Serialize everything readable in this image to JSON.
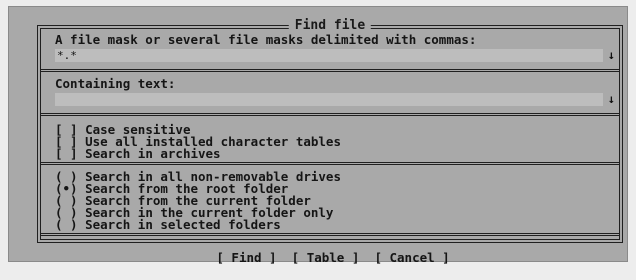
{
  "dialog": {
    "title": "Find file",
    "mask_label": "A file mask or several file masks delimited with commas:",
    "mask_value": "*.*",
    "text_label": "Containing text:",
    "text_value": "",
    "dropdown_arrow": "↓",
    "checkboxes": [
      {
        "mark": "[ ]",
        "label": "Case sensitive"
      },
      {
        "mark": "[ ]",
        "label": "Use all installed character tables"
      },
      {
        "mark": "[ ]",
        "label": "Search in archives"
      }
    ],
    "radios": [
      {
        "mark": "( )",
        "label": "Search in all non-removable drives"
      },
      {
        "mark": "(•)",
        "label": "Search from the root folder"
      },
      {
        "mark": "( )",
        "label": "Search from the current folder"
      },
      {
        "mark": "( )",
        "label": "Search in the current folder only"
      },
      {
        "mark": "( )",
        "label": "Search in selected folders"
      }
    ],
    "buttons": {
      "find": "[ Find ]",
      "table": "[ Table ]",
      "cancel": "[ Cancel ]"
    }
  }
}
